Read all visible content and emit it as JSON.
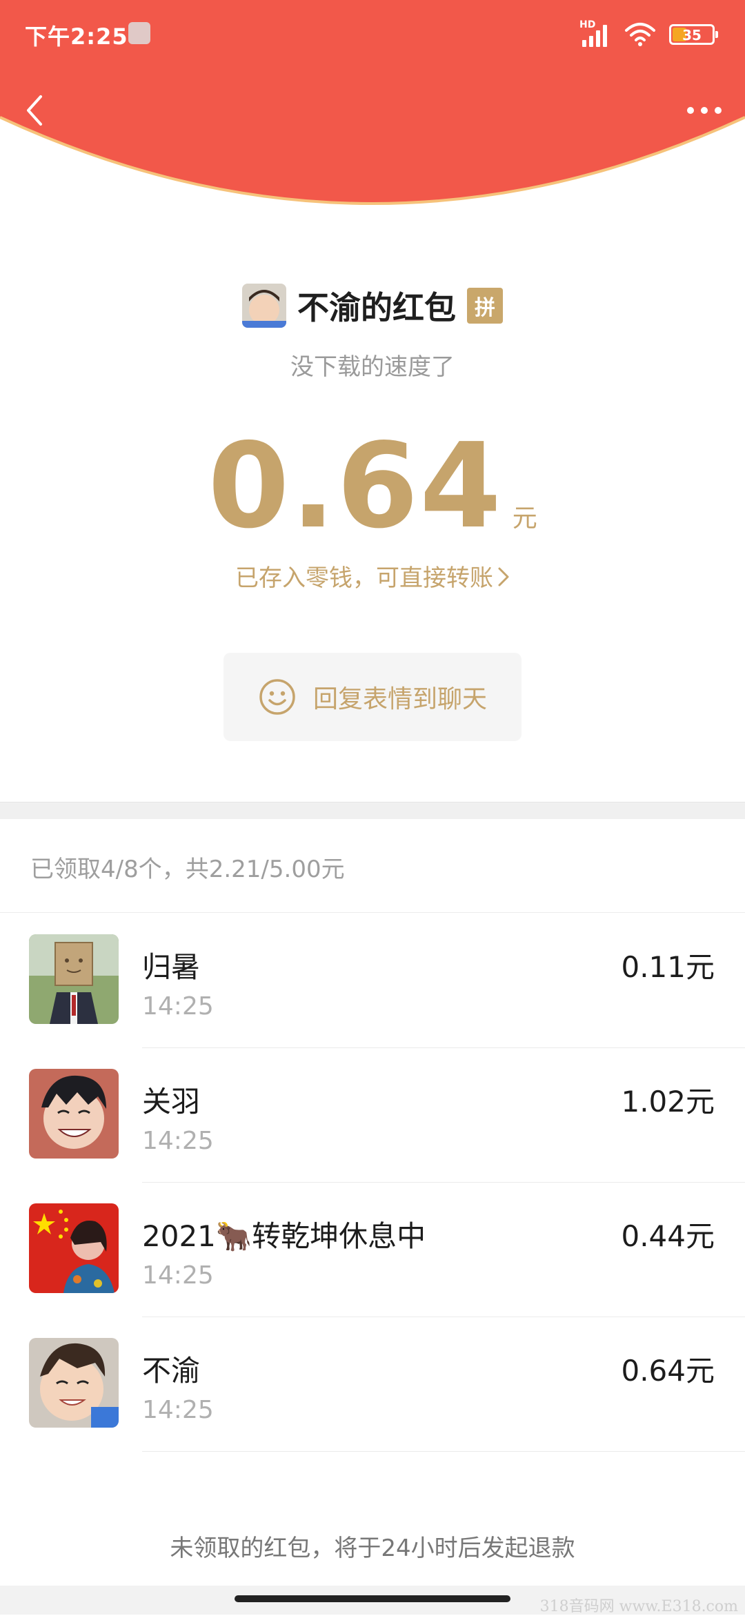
{
  "status_bar": {
    "time": "下午2:25",
    "battery": "35",
    "battery_level": 0.35,
    "network": "HD"
  },
  "header": {
    "bg_color": "#f2584a",
    "curve_edge_color": "#f6c27a",
    "back_icon": "chevron-left-icon",
    "more_icon": "more-horizontal-icon"
  },
  "envelope": {
    "sender_name": "不渝的红包",
    "badge": "拼",
    "greeting": "没下载的速度了",
    "amount": "0.64",
    "unit": "元",
    "stored_note": "已存入零钱，可直接转账",
    "accent_color": "#c6a46c"
  },
  "reply": {
    "icon": "smile-icon",
    "label": "回复表情到聊天"
  },
  "summary": "已领取4/8个，共2.21/5.00元",
  "recipients": [
    {
      "name": "归暑",
      "time": "14:25",
      "amount": "0.11元"
    },
    {
      "name": "关羽",
      "time": "14:25",
      "amount": "1.02元"
    },
    {
      "name": "2021🐂转乾坤休息中",
      "time": "14:25",
      "amount": "0.44元"
    },
    {
      "name": "不渝",
      "time": "14:25",
      "amount": "0.64元"
    }
  ],
  "footer_note": "未领取的红包，将于24小时后发起退款",
  "watermark": "318音码网 www.E318.com"
}
